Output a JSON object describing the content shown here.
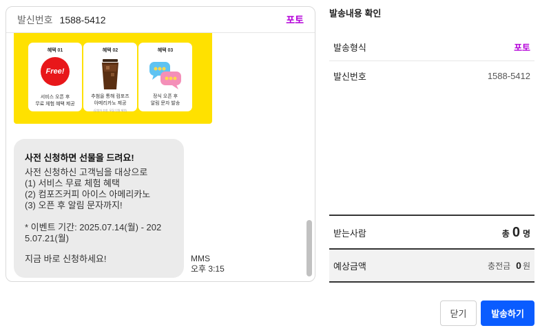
{
  "preview": {
    "sender_label": "발신번호",
    "sender_number": "1588-5412",
    "message_type": "포토",
    "promo_cards": [
      {
        "tag": "혜택 01",
        "badge": "Free!",
        "line1": "서비스 오픈 후",
        "line2": "무료 체험 혜택 제공",
        "line3": ""
      },
      {
        "tag": "혜택 02",
        "badge": "",
        "line1": "추첨을 통해 컴포즈",
        "line2": "아메리카노 제공",
        "line3": "(당첨자 추첨, 모집 인원 제한)"
      },
      {
        "tag": "혜택 03",
        "badge": "",
        "line1": "정식 오픈 후",
        "line2": "알림 문자 발송",
        "line3": ""
      }
    ],
    "bubble": {
      "title": "사전 신청하면 선물을 드려요!",
      "lines": [
        "사전 신청하신 고객님을 대상으로",
        "(1) 서비스 무료 체험 혜택",
        "(2) 컴포즈커피 아이스 아메리카노",
        "(3) 오픈 후 알림 문자까지!"
      ],
      "period_line1": "* 이벤트 기간: 2025.07.14(월) - 202",
      "period_line2": "5.07.21(월)",
      "cta": "지금 바로 신청하세요!"
    },
    "meta_type": "MMS",
    "meta_time": "오후 3:15"
  },
  "confirm": {
    "title": "발송내용 확인",
    "type_label": "발송형식",
    "type_value": "포토",
    "sender_label": "발신번호",
    "sender_value": "1588-5412",
    "recipients_label": "받는사람",
    "recipients_prefix": "총",
    "recipients_count": "0",
    "recipients_unit": "명",
    "cost_label": "예상금액",
    "cost_prefix": "충전금",
    "cost_value": "0",
    "cost_unit": "원"
  },
  "buttons": {
    "close": "닫기",
    "send": "발송하기"
  },
  "colors": {
    "accent_purple": "#b400d9",
    "primary_blue": "#0a5cff",
    "promo_yellow": "#ffe100"
  }
}
